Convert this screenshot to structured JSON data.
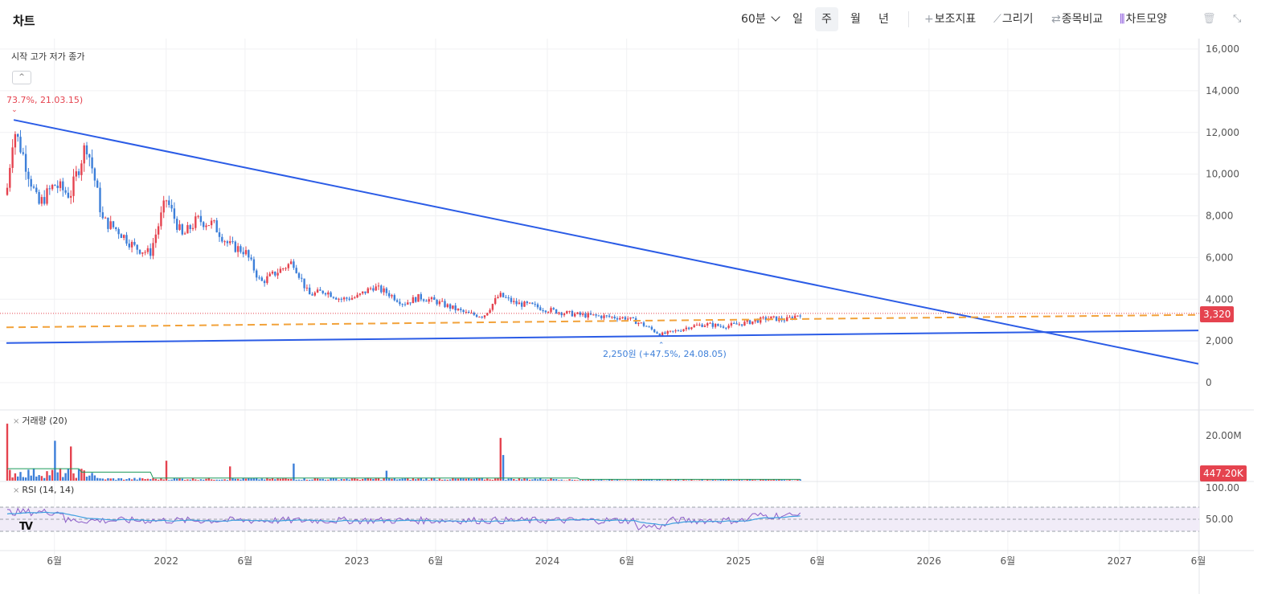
{
  "toolbar": {
    "title": "차트",
    "interval": "60분",
    "periods": [
      "일",
      "주",
      "월",
      "년"
    ],
    "active_period": "주",
    "indicators_label": "보조지표",
    "draw_label": "그리기",
    "compare_label": "종목비교",
    "style_label": "차트모양"
  },
  "legend": {
    "ohlc": "시작 고가 저가 종가"
  },
  "annotations": {
    "high": "73.7%, 21.03.15)",
    "low": "2,250원 (+47.5%, 24.08.05)"
  },
  "price_tag": "3,320",
  "volume_tag": "447.20K",
  "volume_title": "거래량 (20)",
  "rsi_title": "RSI (14, 14)",
  "colors": {
    "up": "#e5434f",
    "down": "#3d7fd9",
    "trend": "#2b5ce6",
    "dash": "#f2a23a",
    "rsi": "#8a5cc8",
    "signal": "#3fa0e0",
    "vma": "#1b9a5a"
  },
  "chart_data": {
    "type": "candlestick",
    "price_axis": {
      "ticks": [
        "16,000",
        "14,000",
        "12,000",
        "10,000",
        "8,000",
        "6,000",
        "4,000",
        "2,000",
        "0"
      ],
      "ylim": [
        0,
        16000
      ]
    },
    "volume_axis": {
      "ticks": [
        "20.00M"
      ]
    },
    "rsi_axis": {
      "ticks": [
        "100.00",
        "50.00"
      ]
    },
    "x_ticks": [
      "6월",
      "2022",
      "6월",
      "2023",
      "6월",
      "2024",
      "6월",
      "2025",
      "6월",
      "2026",
      "6월",
      "2027",
      "6월"
    ],
    "close_path": [
      [
        "2021-03-01",
        9000
      ],
      [
        "2021-03-15",
        12200
      ],
      [
        "2021-04-01",
        11000
      ],
      [
        "2021-05-01",
        8500
      ],
      [
        "2021-06-01",
        9500
      ],
      [
        "2021-07-01",
        9000
      ],
      [
        "2021-08-01",
        11500
      ],
      [
        "2021-08-15",
        10000
      ],
      [
        "2021-09-01",
        7800
      ],
      [
        "2021-10-01",
        7300
      ],
      [
        "2021-11-01",
        6500
      ],
      [
        "2021-12-01",
        6200
      ],
      [
        "2022-01-01",
        8800
      ],
      [
        "2022-02-01",
        7000
      ],
      [
        "2022-03-01",
        7800
      ],
      [
        "2022-04-01",
        7600
      ],
      [
        "2022-05-01",
        6600
      ],
      [
        "2022-06-01",
        6300
      ],
      [
        "2022-07-01",
        4800
      ],
      [
        "2022-08-01",
        5300
      ],
      [
        "2022-09-01",
        5800
      ],
      [
        "2022-10-01",
        4200
      ],
      [
        "2022-11-01",
        4400
      ],
      [
        "2022-12-01",
        4000
      ],
      [
        "2023-01-01",
        4100
      ],
      [
        "2023-02-01",
        4600
      ],
      [
        "2023-03-01",
        4300
      ],
      [
        "2023-04-01",
        3800
      ],
      [
        "2023-05-01",
        4100
      ],
      [
        "2023-06-01",
        3900
      ],
      [
        "2023-07-01",
        3600
      ],
      [
        "2023-08-01",
        3300
      ],
      [
        "2023-09-01",
        3200
      ],
      [
        "2023-10-01",
        4200
      ],
      [
        "2023-11-01",
        3800
      ],
      [
        "2023-12-01",
        3700
      ],
      [
        "2024-01-01",
        3500
      ],
      [
        "2024-02-01",
        3350
      ],
      [
        "2024-03-01",
        3250
      ],
      [
        "2024-04-01",
        3200
      ],
      [
        "2024-05-01",
        3150
      ],
      [
        "2024-06-01",
        3100
      ],
      [
        "2024-07-01",
        2800
      ],
      [
        "2024-08-05",
        2300
      ],
      [
        "2024-09-01",
        2450
      ],
      [
        "2024-10-01",
        2700
      ],
      [
        "2024-11-01",
        2800
      ],
      [
        "2024-12-01",
        2700
      ],
      [
        "2025-01-01",
        2800
      ],
      [
        "2025-02-01",
        2950
      ],
      [
        "2025-03-01",
        3100
      ],
      [
        "2025-04-01",
        3000
      ],
      [
        "2025-05-01",
        3320
      ]
    ],
    "trendlines": [
      {
        "from": [
          "2021-03-15",
          12600
        ],
        "to": [
          "2027-06-01",
          900
        ]
      },
      {
        "from": [
          "2021-03-01",
          1900
        ],
        "to": [
          "2027-06-01",
          2500
        ]
      }
    ],
    "dashed_line": {
      "from": [
        "2021-03-01",
        2650
      ],
      "to": [
        "2027-06-01",
        3250
      ]
    },
    "volume_spikes": [
      [
        "2021-03-01",
        20000000
      ],
      [
        "2021-06-01",
        14000000
      ],
      [
        "2021-07-01",
        12000000
      ],
      [
        "2022-01-01",
        7000000
      ],
      [
        "2022-05-01",
        5000000
      ],
      [
        "2022-09-01",
        6000000
      ],
      [
        "2023-03-01",
        3500000
      ],
      [
        "2023-10-01",
        15000000
      ],
      [
        "2023-10-10",
        9000000
      ]
    ],
    "rsi_levels": [
      70,
      50,
      30
    ]
  }
}
